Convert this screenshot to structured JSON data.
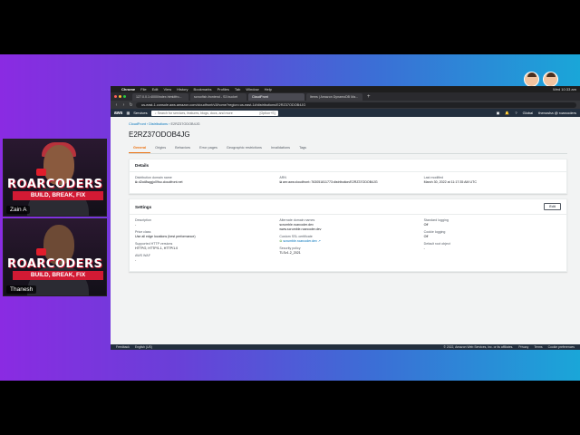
{
  "menubar": {
    "app": "Chrome",
    "items": [
      "File",
      "Edit",
      "View",
      "History",
      "Bookmarks",
      "Profiles",
      "Tab",
      "Window",
      "Help"
    ],
    "clock": "Wed 10:33 am"
  },
  "browser": {
    "tabs": [
      {
        "label": "127.0.0.1:4000/index.html#fro...",
        "active": false
      },
      {
        "label": "scroofish-frontend - S3 bucket",
        "active": false
      },
      {
        "label": "CloudFront",
        "active": true
      },
      {
        "label": "Items | Amazon DynamoDB Ma...",
        "active": false
      }
    ],
    "url": "us-east-1.console.aws.amazon.com/cloudfront/v3/home?region=us-east-1#/distributions/E2RZ37ODOB4JG"
  },
  "aws": {
    "logo": "aws",
    "services": "Services",
    "search_placeholder": "Search for services, features, blogs, docs, and more",
    "search_hint": "[Option+S]",
    "region": "Global",
    "account": "thenosha @ roarcoders"
  },
  "page": {
    "breadcrumb": [
      "CloudFront",
      "Distributions",
      "E2RZ37ODOB4JG"
    ],
    "title": "E2RZ37ODOB4JG",
    "tabs": [
      "General",
      "Origins",
      "Behaviors",
      "Error pages",
      "Geographic restrictions",
      "Invalidations",
      "Tags"
    ]
  },
  "details": {
    "heading": "Details",
    "domain_label": "Distribution domain name",
    "domain_value": "d2cd8sqgjo09so.cloudfront.net",
    "arn_label": "ARN",
    "arn_value": "arn:aws:cloudfront::763051811773:distribution/E2RZ37ODOB4JG",
    "modified_label": "Last modified",
    "modified_value": "March 30, 2022 at 11:17:35 AM UTC"
  },
  "settings": {
    "heading": "Settings",
    "edit_label": "Edit",
    "description_label": "Description",
    "description_value": "-",
    "price_label": "Price class",
    "price_value": "Use all edge locations (best performance)",
    "http_label": "Supported HTTP versions",
    "http_value": "HTTP/2, HTTP/1.1, HTTP/1.0",
    "waf_label": "AWS WAF",
    "waf_value": "-",
    "alt_label": "Alternate domain names",
    "alt_values": [
      "scrumble.roarcoder.dev",
      "www.scrumble.roarcoder.dev"
    ],
    "ssl_label": "Custom SSL certificate",
    "ssl_value": "scrumble.roarcoder.dev",
    "policy_label": "Security policy",
    "policy_value": "TLSv1.2_2021",
    "std_log_label": "Standard logging",
    "std_log_value": "Off",
    "cookie_label": "Cookie logging",
    "cookie_value": "Off",
    "root_label": "Default root object",
    "root_value": "-"
  },
  "footer": {
    "feedback": "Feedback",
    "language": "English (US)",
    "copyright": "© 2022, Amazon Web Services, Inc. or its affiliates.",
    "privacy": "Privacy",
    "terms": "Terms",
    "cookie": "Cookie preferences"
  },
  "cams": [
    {
      "name": "Zain A",
      "brand": "ROARCODERS",
      "tagline": "BUILD, BREAK, FIX"
    },
    {
      "name": "Thanesh",
      "brand": "ROARCODERS",
      "tagline": "BUILD, BREAK, FIX"
    }
  ],
  "colors": {
    "aws_nav": "#232f3e",
    "aws_orange": "#ec7211",
    "link": "#0073bb"
  }
}
